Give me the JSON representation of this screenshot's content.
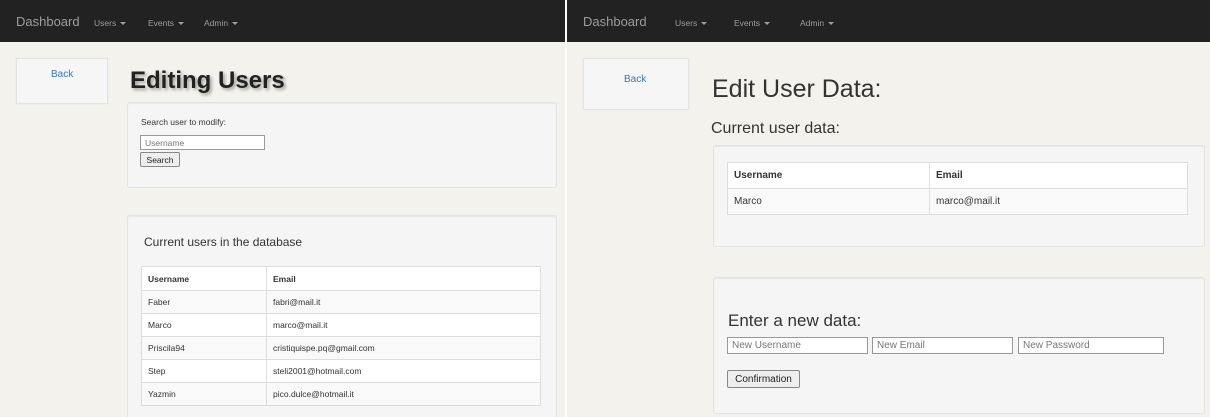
{
  "left": {
    "navbar": {
      "brand": "Dashboard",
      "menus": [
        "Users",
        "Events",
        "Admin"
      ]
    },
    "back_label": "Back",
    "title": "Editing Users",
    "search": {
      "label": "Search user to modify:",
      "placeholder": "Username",
      "button": "Search"
    },
    "users": {
      "heading": "Current users in the database",
      "columns": [
        "Username",
        "Email"
      ],
      "rows": [
        [
          "Faber",
          "fabri@mail.it"
        ],
        [
          "Marco",
          "marco@mail.it"
        ],
        [
          "Priscila94",
          "cristiquispe.pq@gmail.com"
        ],
        [
          "Step",
          "steli2001@hotmail.com"
        ],
        [
          "Yazmin",
          "pico.dulce@hotmail.it"
        ]
      ]
    }
  },
  "right": {
    "navbar": {
      "brand": "Dashboard",
      "menus": [
        "Users",
        "Events",
        "Admin"
      ]
    },
    "back_label": "Back",
    "title": "Edit User Data:",
    "current_heading": "Current user data:",
    "current": {
      "columns": [
        "Username",
        "Email"
      ],
      "rows": [
        [
          "Marco",
          "marco@mail.it"
        ]
      ]
    },
    "new_data": {
      "heading": "Enter a new data:",
      "username_placeholder": "New Username",
      "email_placeholder": "New Email",
      "password_placeholder": "New Password",
      "button": "Confirmation"
    }
  }
}
